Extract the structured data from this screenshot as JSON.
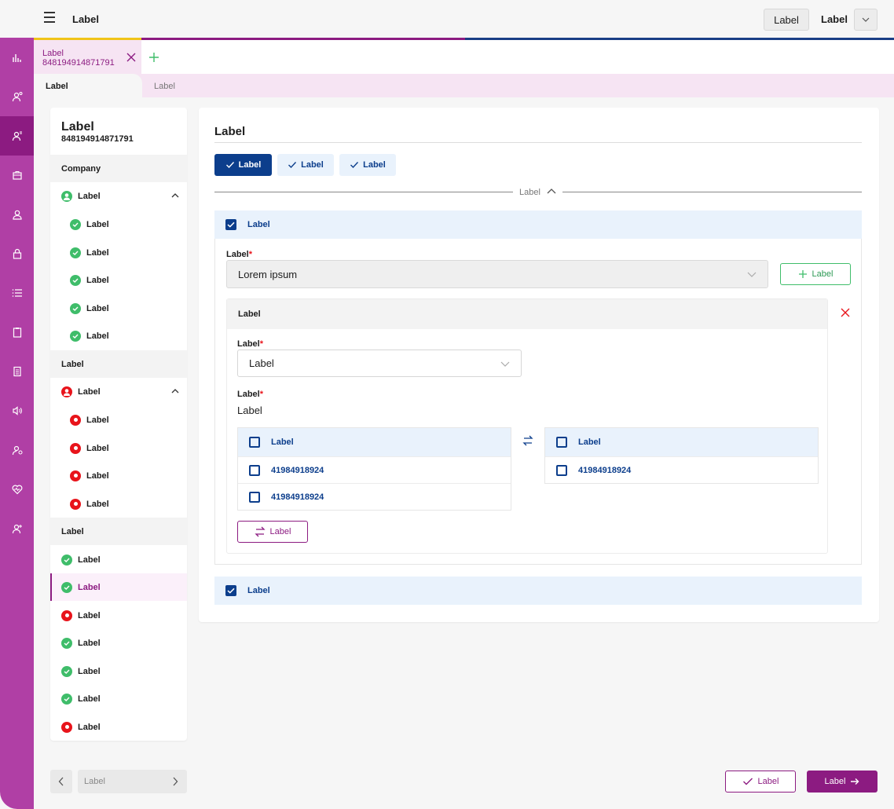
{
  "header": {
    "title": "Label",
    "button_label": "Label",
    "user_label": "Label"
  },
  "tabs": {
    "active_tab_label": "Label",
    "active_tab_id": "848194914871791",
    "subtabs": [
      "Label",
      "Label"
    ]
  },
  "colors": {
    "brand": "#8c1b81",
    "rail": "#b03fa5",
    "primary_blue": "#0c3e8c",
    "success": "#3fbd6a",
    "error": "#e8141b"
  },
  "sidebar": {
    "title": "Label",
    "id": "848194914871791",
    "groups": [
      {
        "label": "Company"
      },
      {
        "label": "Label"
      },
      {
        "label": "Label"
      }
    ],
    "parent1": {
      "label": "Label",
      "status": "ok"
    },
    "parent1_children": [
      "Label",
      "Label",
      "Label",
      "Label",
      "Label"
    ],
    "parent2": {
      "label": "Label",
      "status": "error"
    },
    "parent2_children": [
      "Label",
      "Label",
      "Label",
      "Label"
    ],
    "items": [
      {
        "label": "Label",
        "status": "ok"
      },
      {
        "label": "Label",
        "status": "ok"
      },
      {
        "label": "Label",
        "status": "error"
      },
      {
        "label": "Label",
        "status": "ok"
      },
      {
        "label": "Label",
        "status": "ok"
      },
      {
        "label": "Label",
        "status": "ok"
      },
      {
        "label": "Label",
        "status": "error"
      }
    ],
    "selected_item_index": 1
  },
  "pager": {
    "label": "Label"
  },
  "main": {
    "title": "Label",
    "chips": [
      {
        "label": "Label",
        "active": true
      },
      {
        "label": "Label",
        "active": false
      },
      {
        "label": "Label",
        "active": false
      }
    ],
    "divider_label": "Label",
    "section1": {
      "label": "Label",
      "checked": true,
      "field_label": "Label",
      "select_value": "Lorem ipsum",
      "add_button": "Label",
      "card": {
        "title": "Label",
        "select_label": "Label",
        "select_value": "Label",
        "value_label": "Label",
        "value_text": "Label",
        "left_list": {
          "header": "Label",
          "rows": [
            "41984918924",
            "41984918924"
          ]
        },
        "right_list": {
          "header": "Label",
          "rows": [
            "41984918924"
          ]
        },
        "move_button": "Label"
      }
    },
    "section2": {
      "label": "Label",
      "checked": true
    }
  },
  "footer": {
    "secondary_button": "Label",
    "primary_button": "Label"
  }
}
